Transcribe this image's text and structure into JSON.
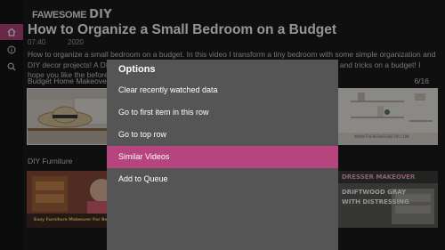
{
  "app": {
    "brand_prefix": "FAWESOME",
    "brand_suffix": "DIY",
    "accent_color": "#b6457f"
  },
  "sidebar": {
    "items": [
      {
        "icon": "home-icon",
        "selected": true
      },
      {
        "icon": "info-icon",
        "selected": false
      },
      {
        "icon": "search-icon",
        "selected": false
      }
    ]
  },
  "feature": {
    "title": "How to Organize a Small Bedroom on a Budget",
    "duration": "07:40",
    "year": "2020",
    "description": "How to organize a small bedroom on a budget. In this video I transform a tiny bedroom with some simple organization and DIY decor projects! A DIY headboard, some space saving shelves, and a whole bunch of tips and tricks on a budget! I hope you like the before a..."
  },
  "rows": [
    {
      "title": "Budget Home Makeover",
      "count": "6/16",
      "thumbnails": [
        {
          "name": "hat-on-headboard-thumbnail"
        },
        {
          "name": "shelf-decor-thumbnail",
          "caption": "WWW.THERESHESDECOR.COM"
        }
      ]
    },
    {
      "title": "DIY Furniture",
      "thumbnails": [
        {
          "name": "furniture-makeover-thumbnail",
          "caption": "Easy Furniture Makeover For Beginners"
        },
        {
          "name": "workshop-thumbnail"
        },
        {
          "name": "table-project-thumbnail"
        },
        {
          "name": "dresser-makeover-thumbnail",
          "caption_line1": "DRESSER MAKEOVER",
          "caption_line2": "DRIFTWOOD GRAY",
          "caption_line3": "WITH DISTRESSING"
        }
      ]
    }
  ],
  "options_dialog": {
    "title": "Options",
    "items": [
      {
        "label": "Clear recently watched data",
        "selected": false
      },
      {
        "label": "Go to first item in this row",
        "selected": false
      },
      {
        "label": "Go to top row",
        "selected": false
      },
      {
        "label": "Similar Videos",
        "selected": true
      },
      {
        "label": "Add to Queue",
        "selected": false
      }
    ]
  }
}
